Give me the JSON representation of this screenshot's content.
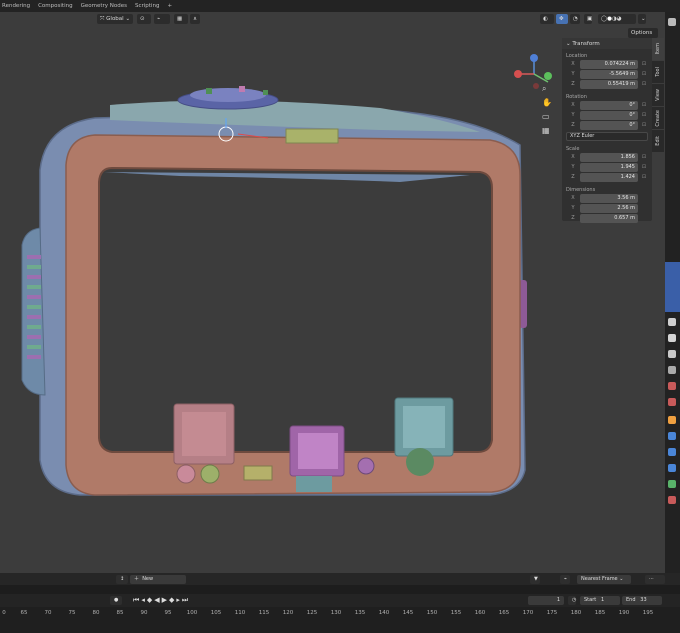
{
  "topbar": {
    "tabs": [
      "Rendering",
      "Compositing",
      "Geometry Nodes",
      "Scripting",
      "+"
    ]
  },
  "header": {
    "orientation": "Global",
    "options": "Options"
  },
  "npanel": {
    "title": "Transform",
    "location_label": "Location",
    "location": [
      {
        "axis": "X",
        "value": "0.074224 m"
      },
      {
        "axis": "Y",
        "value": "-5.5649 m"
      },
      {
        "axis": "Z",
        "value": "0.55419 m"
      }
    ],
    "rotation_label": "Rotation",
    "rotation": [
      {
        "axis": "X",
        "value": "0°"
      },
      {
        "axis": "Y",
        "value": "0°"
      },
      {
        "axis": "Z",
        "value": "0°"
      }
    ],
    "rotation_mode": "XYZ Euler",
    "scale_label": "Scale",
    "scale": [
      {
        "axis": "X",
        "value": "1.856"
      },
      {
        "axis": "Y",
        "value": "1.945"
      },
      {
        "axis": "Z",
        "value": "1.424"
      }
    ],
    "dimensions_label": "Dimensions",
    "dimensions": [
      {
        "axis": "X",
        "value": "3.56 m"
      },
      {
        "axis": "Y",
        "value": "2.56 m"
      },
      {
        "axis": "Z",
        "value": "0.657 m"
      }
    ]
  },
  "sidebar_tabs": [
    "Item",
    "Tool",
    "View",
    "Create",
    "Edit"
  ],
  "timeline": {
    "new_label": "New",
    "keying": "Nearest Frame",
    "current_frame": "1",
    "start_label": "Start",
    "start": "1",
    "end_label": "End",
    "end": "33",
    "ruler": [
      "0",
      "65",
      "70",
      "75",
      "80",
      "85",
      "90",
      "95",
      "100",
      "105",
      "110",
      "115",
      "120",
      "125",
      "130",
      "135",
      "140",
      "145",
      "150",
      "155",
      "160",
      "165",
      "170",
      "175",
      "180",
      "185",
      "190",
      "195"
    ]
  },
  "colors": {
    "viewport": "#3c3c3c",
    "frame_body": "#b07a68",
    "shell": "#7a8db0",
    "teal": "#6d9ba0",
    "accent": "#4772b3"
  }
}
